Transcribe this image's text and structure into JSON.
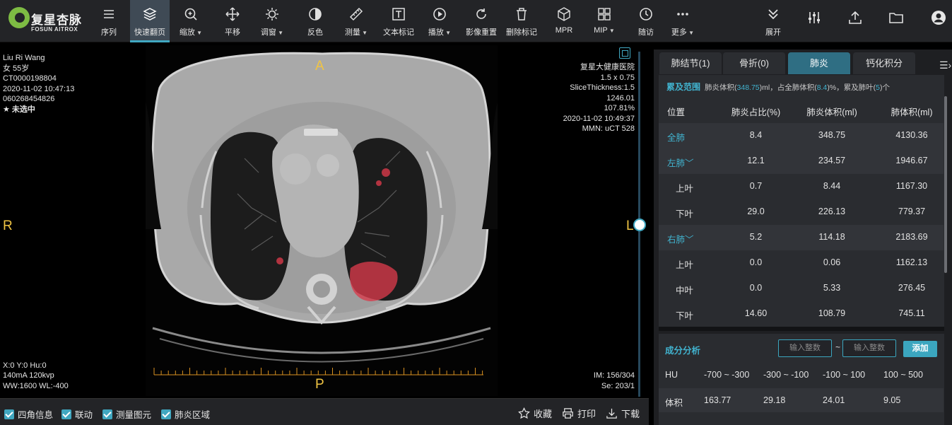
{
  "app": {
    "logo_cn": "复星杏脉",
    "logo_en": "FOSUN AITROX"
  },
  "toolbar": {
    "buttons": [
      {
        "label": "序列",
        "icon": "list-icon"
      },
      {
        "label": "快速翻页",
        "icon": "layers-icon",
        "active": true
      },
      {
        "label": "缩放",
        "icon": "zoom-in-icon",
        "dropdown": true
      },
      {
        "label": "平移",
        "icon": "move-icon"
      },
      {
        "label": "调窗",
        "icon": "sun-icon",
        "dropdown": true
      },
      {
        "label": "反色",
        "icon": "invert-icon"
      },
      {
        "label": "测量",
        "icon": "ruler-icon",
        "dropdown": true
      },
      {
        "label": "文本标记",
        "icon": "text-icon"
      },
      {
        "label": "播放",
        "icon": "play-icon",
        "dropdown": true
      },
      {
        "label": "影像重置",
        "icon": "reset-icon"
      },
      {
        "label": "删除标记",
        "icon": "trash-icon"
      },
      {
        "label": "MPR",
        "icon": "cube-icon"
      },
      {
        "label": "MIP",
        "icon": "mip-icon",
        "dropdown": true
      },
      {
        "label": "随访",
        "icon": "history-icon"
      },
      {
        "label": "更多",
        "icon": "more-icon",
        "dropdown": true
      }
    ],
    "expand_label": "展开",
    "right_icons": [
      "sliders-icon",
      "upload-icon",
      "folder-icon",
      "user-icon"
    ]
  },
  "overlay": {
    "top_left": [
      "Liu Ri Wang",
      "女 55岁",
      "CT0000198804",
      "2020-11-02 10:47:13",
      "060268454826",
      "★ 未选中"
    ],
    "top_right": [
      "复星大健康医院",
      "1.5 x 0.75",
      "SliceThickness:1.5",
      "1246.01",
      "107.81%",
      "2020-11-02 10:49:37",
      "MMN: uCT 528"
    ],
    "bottom_left": [
      "X:0 Y:0 Hu:0",
      "140mA 120kvp",
      "WW:1600 WL:-400"
    ],
    "bottom_right": [
      "IM: 156/304",
      "Se: 203/1"
    ],
    "orientation": {
      "top": "A",
      "bottom": "P",
      "left": "R",
      "right": "L"
    },
    "slice_position": 0.5
  },
  "bottom_bar": {
    "checkboxes": [
      {
        "label": "四角信息",
        "checked": true
      },
      {
        "label": "联动",
        "checked": true
      },
      {
        "label": "测量图元",
        "checked": true
      },
      {
        "label": "肺炎区域",
        "checked": true
      }
    ],
    "actions": [
      {
        "label": "收藏",
        "icon": "star-icon"
      },
      {
        "label": "打印",
        "icon": "printer-icon"
      },
      {
        "label": "下载",
        "icon": "download-icon"
      }
    ]
  },
  "panel": {
    "tabs": [
      "肺结节(1)",
      "骨折(0)",
      "肺炎",
      "钙化积分"
    ],
    "active_tab": 2,
    "involvement": {
      "title": "累及范围",
      "desc_1": "肺炎体积(",
      "volume": "348.75",
      "desc_2": ")ml，占全肺体积(",
      "percent": "8.4",
      "desc_3": ")%，累及肺叶(",
      "lobes": "5",
      "desc_4": ")个"
    },
    "table": {
      "headers": [
        "位置",
        "肺炎占比(%)",
        "肺炎体积(ml)",
        "肺体积(ml)"
      ],
      "rows": [
        {
          "name": "全肺",
          "ratio": "8.4",
          "volume": "348.75",
          "lung": "4130.36",
          "level": 0,
          "link": true
        },
        {
          "name": "左肺",
          "ratio": "12.1",
          "volume": "234.57",
          "lung": "1946.67",
          "level": 0,
          "link": true,
          "expand": true
        },
        {
          "name": "上叶",
          "ratio": "0.7",
          "volume": "8.44",
          "lung": "1167.30",
          "level": 1
        },
        {
          "name": "下叶",
          "ratio": "29.0",
          "volume": "226.13",
          "lung": "779.37",
          "level": 1
        },
        {
          "name": "右肺",
          "ratio": "5.2",
          "volume": "114.18",
          "lung": "2183.69",
          "level": 0,
          "link": true,
          "expand": true
        },
        {
          "name": "上叶",
          "ratio": "0.0",
          "volume": "0.06",
          "lung": "1162.13",
          "level": 1
        },
        {
          "name": "中叶",
          "ratio": "0.0",
          "volume": "5.33",
          "lung": "276.45",
          "level": 1
        },
        {
          "name": "下叶",
          "ratio": "14.60",
          "volume": "108.79",
          "lung": "745.11",
          "level": 1
        }
      ]
    },
    "composition": {
      "title": "成分分析",
      "input_placeholder": "输入整数",
      "separator": "~",
      "add_label": "添加",
      "hu_label": "HU",
      "hu_ranges": [
        "-700 ~ -300",
        "-300 ~ -100",
        "-100 ~ 100",
        "100 ~ 500"
      ],
      "volume_label": "体积",
      "volumes": [
        "163.77",
        "29.18",
        "24.01",
        "9.05"
      ]
    }
  },
  "colors": {
    "accent": "#41a8c2",
    "orientation": "#f0c443",
    "lesion": "#d83a4a",
    "ruler": "#d89020"
  }
}
